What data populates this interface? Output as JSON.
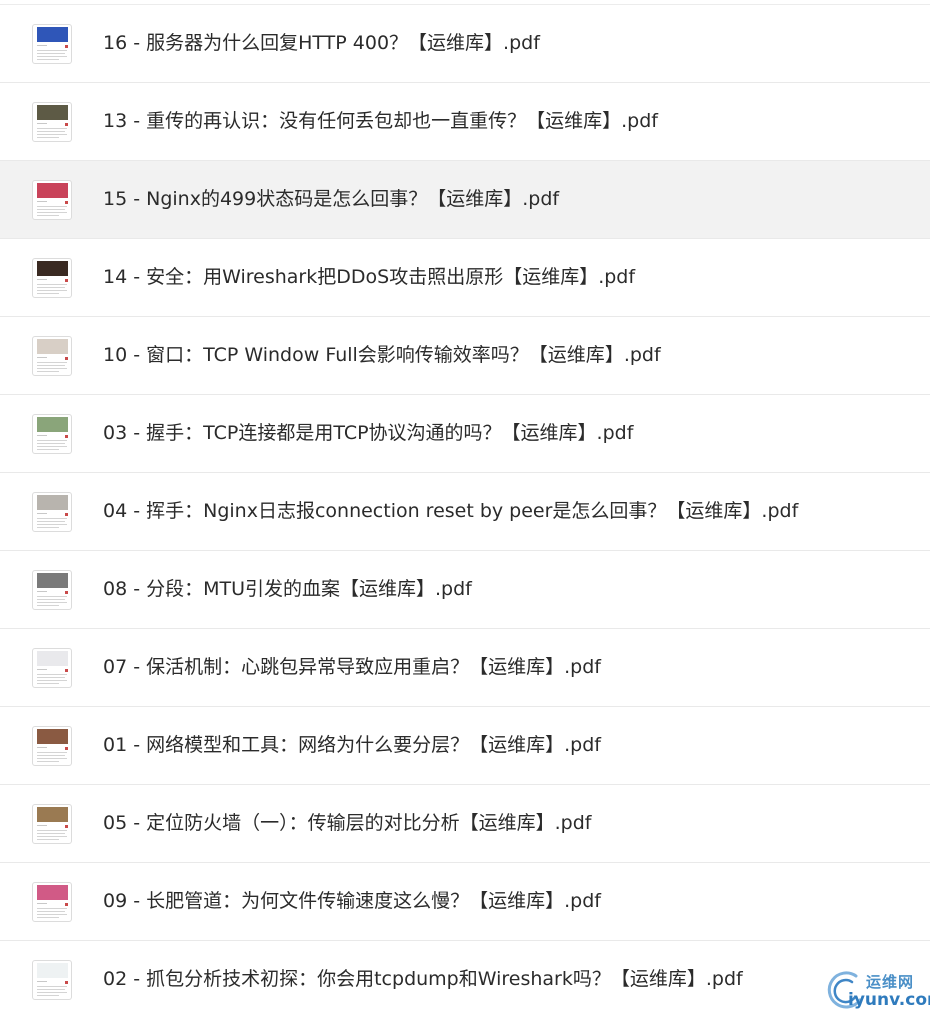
{
  "files": [
    {
      "name": "16 - 服务器为什么回复HTTP 400？【运维库】.pdf",
      "thumb_color": "#2f56b8",
      "selected": false
    },
    {
      "name": "13 - 重传的再认识：没有任何丢包却也一直重传？【运维库】.pdf",
      "thumb_color": "#5d5a45",
      "selected": false
    },
    {
      "name": "15 - Nginx的499状态码是怎么回事？【运维库】.pdf",
      "thumb_color": "#c9435a",
      "selected": true
    },
    {
      "name": "14 - 安全：用Wireshark把DDoS攻击照出原形【运维库】.pdf",
      "thumb_color": "#3a2a22",
      "selected": false
    },
    {
      "name": "10 - 窗口：TCP Window Full会影响传输效率吗？【运维库】.pdf",
      "thumb_color": "#d8cfc6",
      "selected": false
    },
    {
      "name": "03 - 握手：TCP连接都是用TCP协议沟通的吗？【运维库】.pdf",
      "thumb_color": "#8aa57a",
      "selected": false
    },
    {
      "name": "04 - 挥手：Nginx日志报connection reset by peer是怎么回事？【运维库】.pdf",
      "thumb_color": "#b8b4ae",
      "selected": false
    },
    {
      "name": "08 - 分段：MTU引发的血案【运维库】.pdf",
      "thumb_color": "#7a7a7a",
      "selected": false
    },
    {
      "name": "07 - 保活机制：心跳包异常导致应用重启？【运维库】.pdf",
      "thumb_color": "#e9e9ec",
      "selected": false
    },
    {
      "name": "01 - 网络模型和工具：网络为什么要分层？【运维库】.pdf",
      "thumb_color": "#8a5a42",
      "selected": false
    },
    {
      "name": "05 - 定位防火墙（一）：传输层的对比分析【运维库】.pdf",
      "thumb_color": "#9a7a52",
      "selected": false
    },
    {
      "name": "09 - 长肥管道：为何文件传输速度这么慢？【运维库】.pdf",
      "thumb_color": "#d15a86",
      "selected": false
    },
    {
      "name": "02 - 抓包分析技术初探：你会用tcpdump和Wireshark吗？【运维库】.pdf",
      "thumb_color": "#eef2f3",
      "selected": false
    }
  ],
  "watermark": {
    "cn": "运维网",
    "en": "iyunv.com",
    "icon": "iyunv-logo-icon"
  }
}
